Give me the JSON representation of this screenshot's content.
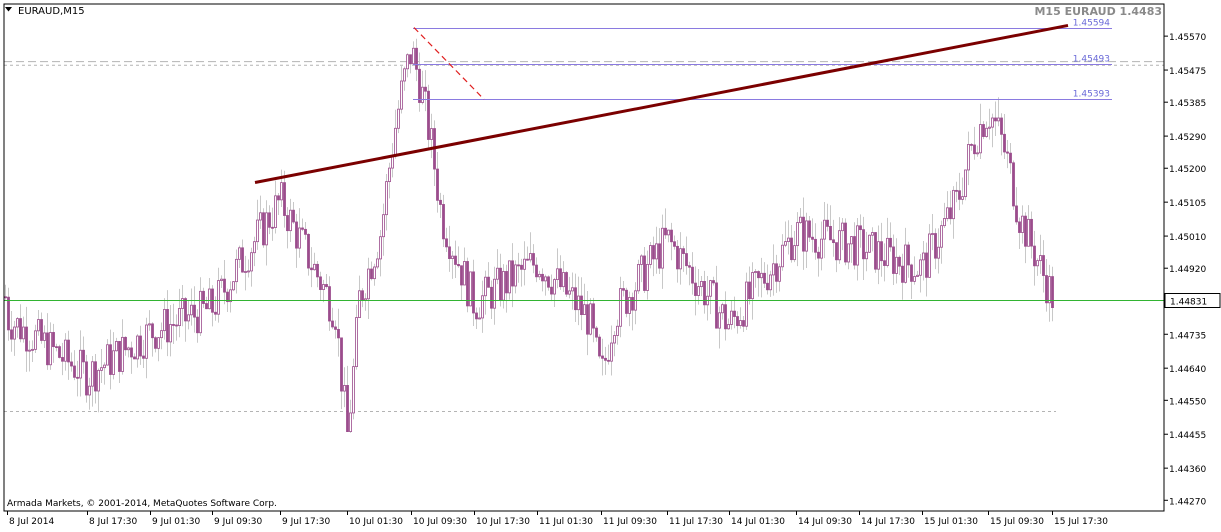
{
  "header": {
    "symbol_label": "EURAUD,M15",
    "info_label": "M15 EURAUD 1.4483"
  },
  "footer": {
    "copyright": "Armada Markets, © 2001-2014, MetaQuotes Software Corp."
  },
  "colors": {
    "background": "#ffffff",
    "frame": "#000000",
    "candle": "#9b4c8c",
    "wick": "#c8c8c8",
    "trendline": "#7b0000",
    "level_line": "#8a7ae0",
    "level_text": "#6a6ad8",
    "price_line": "#32b432",
    "dashed_line": "#b4b4b4",
    "red_dashed": "#e01e1e",
    "info_text": "#8a8a8a"
  },
  "chart_data": {
    "type": "candlestick",
    "title": "M15 EURAUD 1.4483",
    "symbol": "EURAUD",
    "timeframe": "M15",
    "current_price": "1.44831",
    "ylim": [
      1.4424,
      1.4566
    ],
    "y_ticks": [
      "1.45570",
      "1.45475",
      "1.45385",
      "1.45290",
      "1.45200",
      "1.45105",
      "1.45010",
      "1.44920",
      "1.44825",
      "1.44735",
      "1.44640",
      "1.44550",
      "1.44455",
      "1.44360",
      "1.44270"
    ],
    "x_ticks": [
      "8 Jul 2014",
      "8 Jul 17:30",
      "9 Jul 01:30",
      "9 Jul 09:30",
      "9 Jul 17:30",
      "10 Jul 01:30",
      "10 Jul 09:30",
      "10 Jul 17:30",
      "11 Jul 01:30",
      "11 Jul 09:30",
      "11 Jul 17:30",
      "14 Jul 01:30",
      "14 Jul 09:30",
      "14 Jul 17:30",
      "15 Jul 01:30",
      "15 Jul 09:30",
      "15 Jul 17:30"
    ],
    "levels": [
      {
        "label": "1.45594",
        "value": 1.45594
      },
      {
        "label": "1.45493",
        "value": 1.45493
      },
      {
        "label": "1.45393",
        "value": 1.45393
      }
    ],
    "dashed_levels": [
      1.4549,
      1.455,
      1.4452
    ],
    "trendline": {
      "from": {
        "time": "9 Jul 17:30",
        "price": 1.4516
      },
      "to": {
        "time": "15 Jul 17:30",
        "price": 1.456
      }
    },
    "close_path": [
      [
        "8 Jul 2014",
        1.4478
      ],
      [
        "8 Jul 17:30",
        1.4462
      ],
      [
        "9 Jul 01:30",
        1.4474
      ],
      [
        "9 Jul 09:30",
        1.4481
      ],
      [
        "9 Jul 17:30",
        1.4511
      ],
      [
        "10 Jul 01:30",
        1.4473
      ],
      [
        "10 Jul 09:30",
        1.4529
      ],
      [
        "10 Jul 17:30",
        1.4482
      ],
      [
        "11 Jul 01:30",
        1.4494
      ],
      [
        "11 Jul 09:30",
        1.4474
      ],
      [
        "11 Jul 17:30",
        1.45
      ],
      [
        "14 Jul 01:30",
        1.4476
      ],
      [
        "14 Jul 09:30",
        1.4502
      ],
      [
        "14 Jul 17:30",
        1.4498
      ],
      [
        "15 Jul 01:30",
        1.4492
      ],
      [
        "15 Jul 09:30",
        1.4528
      ],
      [
        "15 Jul 17:30",
        1.4484
      ]
    ],
    "peaks": [
      {
        "time": "10 Jul 09:30",
        "price": 1.4557
      },
      {
        "time": "15 Jul 09:30",
        "price": 1.4537
      }
    ],
    "troughs": [
      {
        "time": "10 Jul 01:30",
        "price": 1.4427
      },
      {
        "time": "11 Jul 09:30",
        "price": 1.4453
      }
    ],
    "grid": false
  }
}
